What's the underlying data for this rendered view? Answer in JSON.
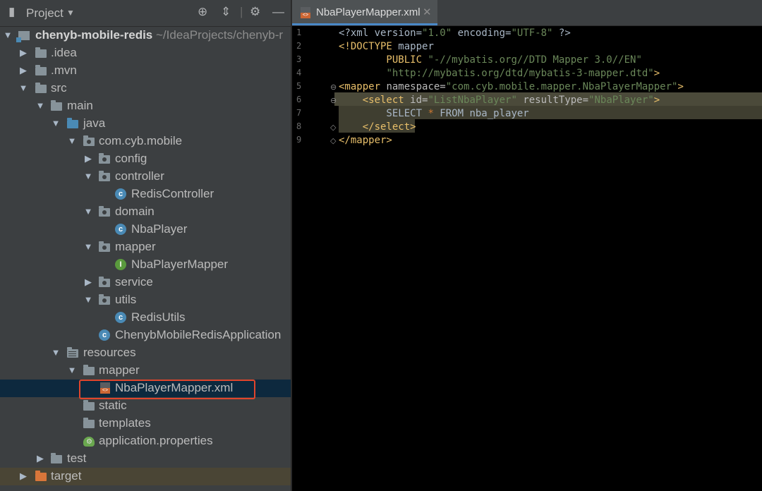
{
  "sidebar": {
    "title": "Project",
    "tree": [
      {
        "label": "chenyb-mobile-redis",
        "path": "~/IdeaProjects/chenyb-r"
      },
      {
        "label": ".idea"
      },
      {
        "label": ".mvn"
      },
      {
        "label": "src"
      },
      {
        "label": "main"
      },
      {
        "label": "java"
      },
      {
        "label": "com.cyb.mobile"
      },
      {
        "label": "config"
      },
      {
        "label": "controller"
      },
      {
        "label": "RedisController"
      },
      {
        "label": "domain"
      },
      {
        "label": "NbaPlayer"
      },
      {
        "label": "mapper"
      },
      {
        "label": "NbaPlayerMapper"
      },
      {
        "label": "service"
      },
      {
        "label": "utils"
      },
      {
        "label": "RedisUtils"
      },
      {
        "label": "ChenybMobileRedisApplication"
      },
      {
        "label": "resources"
      },
      {
        "label": "mapper"
      },
      {
        "label": "NbaPlayerMapper.xml"
      },
      {
        "label": "static"
      },
      {
        "label": "templates"
      },
      {
        "label": "application.properties"
      },
      {
        "label": "test"
      },
      {
        "label": "target"
      }
    ]
  },
  "editor": {
    "tab_label": "NbaPlayerMapper.xml",
    "line_numbers": [
      "1",
      "2",
      "3",
      "4",
      "5",
      "6",
      "7",
      "8",
      "9"
    ],
    "lines": [
      [
        {
          "t": "<?xml version=",
          "c": "t-plain"
        },
        {
          "t": "\"1.0\"",
          "c": "t-str"
        },
        {
          "t": " encoding=",
          "c": "t-plain"
        },
        {
          "t": "\"UTF-8\"",
          "c": "t-str"
        },
        {
          "t": " ?>",
          "c": "t-plain"
        }
      ],
      [
        {
          "t": "<!DOCTYPE ",
          "c": "t-tag"
        },
        {
          "t": "mapper",
          "c": "t-plain"
        }
      ],
      [
        {
          "t": "        PUBLIC ",
          "c": "t-tag"
        },
        {
          "t": "\"-//mybatis.org//DTD Mapper 3.0//EN\"",
          "c": "t-str"
        }
      ],
      [
        {
          "t": "        ",
          "c": "t-plain"
        },
        {
          "t": "\"http://mybatis.org/dtd/mybatis-3-mapper.dtd\"",
          "c": "t-str"
        },
        {
          "t": ">",
          "c": "t-tag"
        }
      ],
      [
        {
          "t": "<mapper ",
          "c": "t-tag"
        },
        {
          "t": "namespace=",
          "c": "t-attr"
        },
        {
          "t": "\"com.cyb.mobile.mapper.NbaPlayerMapper\"",
          "c": "t-str"
        },
        {
          "t": ">",
          "c": "t-tag"
        }
      ],
      [
        {
          "t": "    <select ",
          "c": "t-tag"
        },
        {
          "t": "id=",
          "c": "t-attr"
        },
        {
          "t": "\"ListNbaPlayer\"",
          "c": "t-str"
        },
        {
          "t": " resultType=",
          "c": "t-attr"
        },
        {
          "t": "\"NbaPlayer\"",
          "c": "t-str"
        },
        {
          "t": ">",
          "c": "t-tag"
        }
      ],
      [
        {
          "t": "        SELECT ",
          "c": "t-plain"
        },
        {
          "t": "*",
          "c": "t-kw"
        },
        {
          "t": " FROM nba_player",
          "c": "t-plain"
        }
      ],
      [
        {
          "t": "    </select>",
          "c": "t-tag"
        }
      ],
      [
        {
          "t": "</mapper>",
          "c": "t-tag"
        }
      ]
    ]
  }
}
